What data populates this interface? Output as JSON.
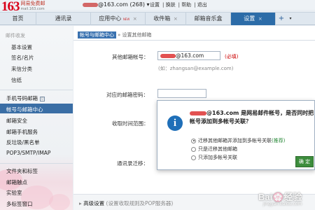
{
  "header": {
    "logo_num": "163",
    "logo_cn": "网易免费邮",
    "logo_url": "mail.163.com",
    "user_suffix": "@163.com (268)",
    "user_arrow": "▾",
    "links": [
      "设置",
      "换肤",
      "帮助",
      "退出"
    ]
  },
  "tabs": [
    {
      "label": "首页"
    },
    {
      "label": "通讯录"
    },
    {
      "label": "应用中心",
      "badge": "NEW"
    },
    {
      "label": "收件箱"
    },
    {
      "label": "邮箱音乐盒"
    },
    {
      "label": "设置"
    }
  ],
  "tab_close": "×",
  "tab_add": "+",
  "tab_dropdown": "▾",
  "sidebar": {
    "section1_header": "邮件收发",
    "section1_items": [
      "基本设置",
      "签名/名片",
      "来信分类",
      "信纸"
    ],
    "main_items": [
      "手机号码邮箱",
      "帐号与邮箱中心",
      "邮箱安全",
      "邮箱手机服务",
      "反垃圾/黑名单",
      "POP3/SMTP/IMAP"
    ],
    "bottom_items": [
      "文件夹和标签",
      "邮箱触点",
      "实验室",
      "多标签窗口"
    ]
  },
  "main": {
    "breadcrumb_active": "帐号与邮箱中心",
    "breadcrumb_page": "» 设置其他邮箱",
    "form": {
      "other_email_label": "其他邮箱帐号：",
      "other_email_value_suffix": "@163.com",
      "required": "(必填)",
      "example": "(如：zhangsan@example.com)",
      "password_label": "对应的邮箱密码：",
      "receive_time_label": "收取时间范围：",
      "contacts_label": "通讯录迁移："
    },
    "advanced": {
      "arrow": "▸",
      "label": "高级设置",
      "note": "(设置收取规则及POP服务器)"
    }
  },
  "dialog": {
    "icon": "i",
    "message_suffix": "@163.com 是网易邮件帐号，是否同时把帐号添加到多帐号关联？",
    "options": [
      {
        "label": "迁移其他邮箱并添加到多帐号关联",
        "tag": "(推荐)",
        "selected": true
      },
      {
        "label": "只是迁移其他邮箱",
        "tag": "",
        "selected": false
      },
      {
        "label": "只添加多帐号关联",
        "tag": "",
        "selected": false
      }
    ],
    "ok_label": "确 定"
  },
  "watermark": {
    "text": "Bai💮经验",
    "url": "jingyan.baidu.com"
  },
  "colors": {
    "active_tab": "#2c6ca8",
    "sidebar_active": "#3a6ea5",
    "info_icon": "#1f6fb8",
    "ok_button": "#3d8d3d",
    "required": "#cc0000"
  }
}
